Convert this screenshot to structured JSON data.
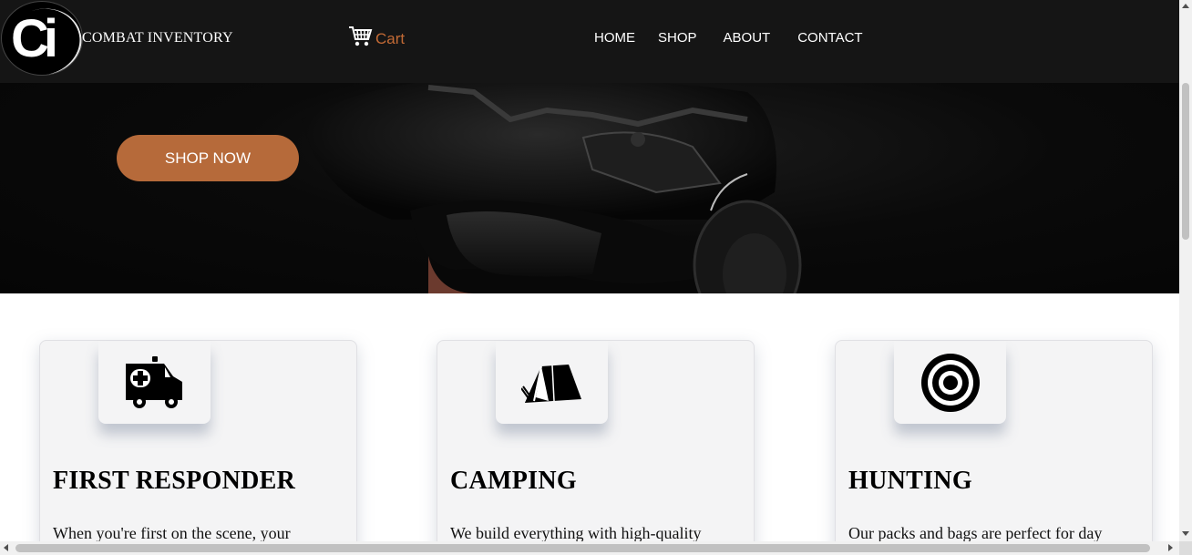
{
  "header": {
    "logo_text": "Ci",
    "brand": "COMBAT INVENTORY",
    "cart_label": "Cart",
    "nav": [
      "HOME",
      "SHOP",
      "ABOUT",
      "CONTACT"
    ]
  },
  "hero": {
    "cta_label": "SHOP NOW"
  },
  "cards": [
    {
      "icon": "ambulance-icon",
      "title": "FIRST RESPONDER",
      "text": "When you're first on the scene, your"
    },
    {
      "icon": "tent-icon",
      "title": "CAMPING",
      "text": "We build everything with high-quality"
    },
    {
      "icon": "target-icon",
      "title": "HUNTING",
      "text": "Our packs and bags are perfect for day"
    }
  ],
  "colors": {
    "header_bg": "#151515",
    "accent": "#b66a3a",
    "cart_text": "#c36a35",
    "card_bg": "#f4f4f5"
  }
}
